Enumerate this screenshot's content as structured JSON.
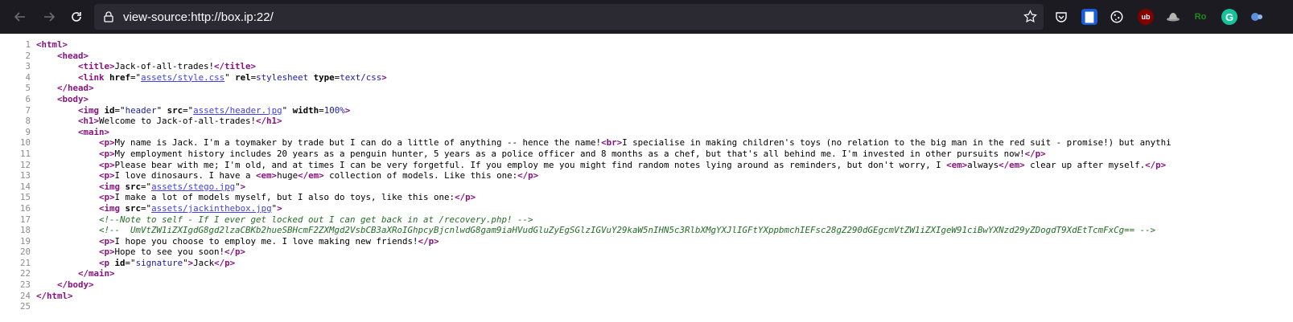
{
  "browser": {
    "url": "view-source:http://box.ip:22/",
    "back_icon": "back-arrow-icon",
    "forward_icon": "forward-arrow-icon",
    "reload_icon": "reload-icon",
    "extensions": [
      "pocket-icon",
      "bitwarden-icon",
      "cookie-icon",
      "ublock-icon",
      "hat-icon",
      "proxy-icon",
      "grammarly-icon",
      "wappalyzer-icon"
    ],
    "ext_labels": {
      "bitwarden": "▇",
      "ublock": "ub",
      "proxy": "Ro",
      "grammarly": "G"
    }
  },
  "source": {
    "lines": [
      {
        "n": "1",
        "indent": "",
        "parts": [
          {
            "t": "tag",
            "v": "<html>"
          }
        ]
      },
      {
        "n": "2",
        "indent": "    ",
        "parts": [
          {
            "t": "tag",
            "v": "<head>"
          }
        ]
      },
      {
        "n": "3",
        "indent": "        ",
        "parts": [
          {
            "t": "tag",
            "v": "<title>"
          },
          {
            "t": "text",
            "v": "Jack-of-all-trades!"
          },
          {
            "t": "tag",
            "v": "</title>"
          }
        ]
      },
      {
        "n": "4",
        "indent": "        ",
        "parts": [
          {
            "t": "tag",
            "v": "<link "
          },
          {
            "t": "attr-name",
            "v": "href"
          },
          {
            "t": "text",
            "v": "=\""
          },
          {
            "t": "link",
            "v": "assets/style.css"
          },
          {
            "t": "text",
            "v": "\" "
          },
          {
            "t": "attr-name",
            "v": "rel"
          },
          {
            "t": "text",
            "v": "="
          },
          {
            "t": "attr-value",
            "v": "stylesheet"
          },
          {
            "t": "text",
            "v": " "
          },
          {
            "t": "attr-name",
            "v": "type"
          },
          {
            "t": "text",
            "v": "="
          },
          {
            "t": "attr-value",
            "v": "text/css"
          },
          {
            "t": "tag",
            "v": ">"
          }
        ]
      },
      {
        "n": "5",
        "indent": "    ",
        "parts": [
          {
            "t": "tag",
            "v": "</head>"
          }
        ]
      },
      {
        "n": "6",
        "indent": "    ",
        "parts": [
          {
            "t": "tag",
            "v": "<body>"
          }
        ]
      },
      {
        "n": "7",
        "indent": "        ",
        "parts": [
          {
            "t": "tag",
            "v": "<img "
          },
          {
            "t": "attr-name",
            "v": "id"
          },
          {
            "t": "text",
            "v": "=\""
          },
          {
            "t": "attr-value",
            "v": "header"
          },
          {
            "t": "text",
            "v": "\" "
          },
          {
            "t": "attr-name",
            "v": "src"
          },
          {
            "t": "text",
            "v": "=\""
          },
          {
            "t": "link",
            "v": "assets/header.jpg"
          },
          {
            "t": "text",
            "v": "\" "
          },
          {
            "t": "attr-name",
            "v": "width"
          },
          {
            "t": "text",
            "v": "="
          },
          {
            "t": "attr-value",
            "v": "100%"
          },
          {
            "t": "tag",
            "v": ">"
          }
        ]
      },
      {
        "n": "8",
        "indent": "        ",
        "parts": [
          {
            "t": "tag",
            "v": "<h1>"
          },
          {
            "t": "text",
            "v": "Welcome to Jack-of-all-trades!"
          },
          {
            "t": "tag",
            "v": "</h1>"
          }
        ]
      },
      {
        "n": "9",
        "indent": "        ",
        "parts": [
          {
            "t": "tag",
            "v": "<main>"
          }
        ]
      },
      {
        "n": "10",
        "indent": "            ",
        "parts": [
          {
            "t": "tag",
            "v": "<p>"
          },
          {
            "t": "text",
            "v": "My name is Jack. I'm a toymaker by trade but I can do a little of anything -- hence the name!"
          },
          {
            "t": "tag",
            "v": "<br>"
          },
          {
            "t": "text",
            "v": "I specialise in making children's toys (no relation to the big man in the red suit - promise!) but anythi"
          }
        ]
      },
      {
        "n": "11",
        "indent": "            ",
        "parts": [
          {
            "t": "tag",
            "v": "<p>"
          },
          {
            "t": "text",
            "v": "My employment history includes 20 years as a penguin hunter, 5 years as a police officer and 8 months as a chef, but that's all behind me. I'm invested in other pursuits now!"
          },
          {
            "t": "tag",
            "v": "</p>"
          }
        ]
      },
      {
        "n": "12",
        "indent": "            ",
        "parts": [
          {
            "t": "tag",
            "v": "<p>"
          },
          {
            "t": "text",
            "v": "Please bear with me; I'm old, and at times I can be very forgetful. If you employ me you might find random notes lying around as reminders, but don't worry, I "
          },
          {
            "t": "tag",
            "v": "<em>"
          },
          {
            "t": "text",
            "v": "always"
          },
          {
            "t": "tag",
            "v": "</em>"
          },
          {
            "t": "text",
            "v": " clear up after myself."
          },
          {
            "t": "tag",
            "v": "</p>"
          }
        ]
      },
      {
        "n": "13",
        "indent": "            ",
        "parts": [
          {
            "t": "tag",
            "v": "<p>"
          },
          {
            "t": "text",
            "v": "I love dinosaurs. I have a "
          },
          {
            "t": "tag",
            "v": "<em>"
          },
          {
            "t": "text",
            "v": "huge"
          },
          {
            "t": "tag",
            "v": "</em>"
          },
          {
            "t": "text",
            "v": " collection of models. Like this one:"
          },
          {
            "t": "tag",
            "v": "</p>"
          }
        ]
      },
      {
        "n": "14",
        "indent": "            ",
        "parts": [
          {
            "t": "tag",
            "v": "<img "
          },
          {
            "t": "attr-name",
            "v": "src"
          },
          {
            "t": "text",
            "v": "=\""
          },
          {
            "t": "link",
            "v": "assets/stego.jpg"
          },
          {
            "t": "text",
            "v": "\""
          },
          {
            "t": "tag",
            "v": ">"
          }
        ]
      },
      {
        "n": "15",
        "indent": "            ",
        "parts": [
          {
            "t": "tag",
            "v": "<p>"
          },
          {
            "t": "text",
            "v": "I make a lot of models myself, but I also do toys, like this one:"
          },
          {
            "t": "tag",
            "v": "</p>"
          }
        ]
      },
      {
        "n": "16",
        "indent": "            ",
        "parts": [
          {
            "t": "tag",
            "v": "<img "
          },
          {
            "t": "attr-name",
            "v": "src"
          },
          {
            "t": "text",
            "v": "=\""
          },
          {
            "t": "link",
            "v": "assets/jackinthebox.jpg"
          },
          {
            "t": "text",
            "v": "\""
          },
          {
            "t": "tag",
            "v": ">"
          }
        ]
      },
      {
        "n": "17",
        "indent": "            ",
        "parts": [
          {
            "t": "comment",
            "v": "<!--Note to self - If I ever get locked out I can get back in at /recovery.php! -->"
          }
        ]
      },
      {
        "n": "18",
        "indent": "            ",
        "parts": [
          {
            "t": "comment",
            "v": "<!--  UmVtZW1iZXIgdG8gd2lzaCBKb2hueSBHcmF2ZXMgd2VsbCB3aXRoIGhpcyBjcnlwdG8gam9iaHVudGluZyEgSGlzIGVuY29kaW5nIHN5c3RlbXMgYXJlIGFtYXppbmchIEFsc28gZ290dGEgcmVtZW1iZXIgeW91ciBwYXNzd29yZDogdT9XdEtTcmFxCg== -->"
          }
        ]
      },
      {
        "n": "19",
        "indent": "            ",
        "parts": [
          {
            "t": "tag",
            "v": "<p>"
          },
          {
            "t": "text",
            "v": "I hope you choose to employ me. I love making new friends!"
          },
          {
            "t": "tag",
            "v": "</p>"
          }
        ]
      },
      {
        "n": "20",
        "indent": "            ",
        "parts": [
          {
            "t": "tag",
            "v": "<p>"
          },
          {
            "t": "text",
            "v": "Hope to see you soon!"
          },
          {
            "t": "tag",
            "v": "</p>"
          }
        ]
      },
      {
        "n": "21",
        "indent": "            ",
        "parts": [
          {
            "t": "tag",
            "v": "<p "
          },
          {
            "t": "attr-name",
            "v": "id"
          },
          {
            "t": "text",
            "v": "=\""
          },
          {
            "t": "attr-value",
            "v": "signature"
          },
          {
            "t": "text",
            "v": "\""
          },
          {
            "t": "tag",
            "v": ">"
          },
          {
            "t": "text",
            "v": "Jack"
          },
          {
            "t": "tag",
            "v": "</p>"
          }
        ]
      },
      {
        "n": "22",
        "indent": "        ",
        "parts": [
          {
            "t": "tag",
            "v": "</main>"
          }
        ]
      },
      {
        "n": "23",
        "indent": "    ",
        "parts": [
          {
            "t": "tag",
            "v": "</body>"
          }
        ]
      },
      {
        "n": "24",
        "indent": "",
        "parts": [
          {
            "t": "tag",
            "v": "</html>"
          }
        ]
      },
      {
        "n": "25",
        "indent": "",
        "parts": []
      }
    ]
  }
}
